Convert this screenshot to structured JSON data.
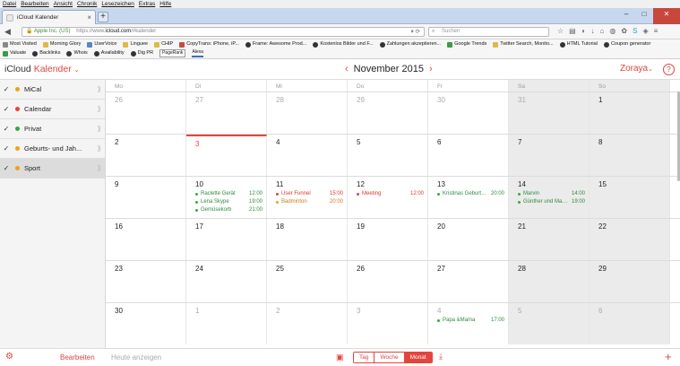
{
  "browser": {
    "menu": [
      "Datei",
      "Bearbeiten",
      "Ansicht",
      "Chronik",
      "Lesezeichen",
      "Extras",
      "Hilfe"
    ],
    "tab_title": "iCloud Kalender",
    "url_identity": "Apple Inc. (US)",
    "url_prefix": "https://www.",
    "url_domain": "icloud.com",
    "url_path": "/#kalender",
    "search_placeholder": "Suchen",
    "bookmarks_row1": [
      "Most Visited",
      "Morning Glory",
      "UserVoice",
      "Linguee",
      "CHIP",
      "CopyTrans: iPhone, iP...",
      "Frame: Awesome Prod...",
      "Kostenlos Bilder und F...",
      "Zahlungen akzeptieren...",
      "Google Trends",
      "Twitter Search, Monito...",
      "HTML Tutorial",
      "Coupon generator"
    ],
    "bookmarks_row2": [
      "Valuate",
      "Backlinks",
      "Whois",
      "Availability",
      "Dig PR",
      "PageRank",
      "Alexa"
    ]
  },
  "app": {
    "brand": "iCloud",
    "module": "Kalender",
    "month": "November",
    "year": "2015",
    "user": "Zoraya",
    "help": "?"
  },
  "sidebar": {
    "calendars": [
      {
        "name": "MiCal",
        "color": "#f0a020"
      },
      {
        "name": "Calendar",
        "color": "#e2453c"
      },
      {
        "name": "Privat",
        "color": "#3aa64a"
      },
      {
        "name": "Geburts- und Jah...",
        "color": "#f0a020"
      },
      {
        "name": "Sport",
        "color": "#f0a020"
      }
    ]
  },
  "bottom": {
    "edit_label": "Bearbeiten",
    "today_label": "Heute anzeigen",
    "views": [
      "Tag",
      "Woche",
      "Monat"
    ],
    "active_view": "Monat"
  },
  "calendar": {
    "weekdays": [
      "Mo",
      "Di",
      "Mi",
      "Do",
      "Fr",
      "Sa",
      "So"
    ],
    "weeks": [
      [
        {
          "d": "26",
          "o": true
        },
        {
          "d": "27",
          "o": true
        },
        {
          "d": "28",
          "o": true
        },
        {
          "d": "29",
          "o": true
        },
        {
          "d": "30",
          "o": true
        },
        {
          "d": "31",
          "o": true
        },
        {
          "d": "1"
        }
      ],
      [
        {
          "d": "2"
        },
        {
          "d": "3",
          "today": true
        },
        {
          "d": "4"
        },
        {
          "d": "5"
        },
        {
          "d": "6"
        },
        {
          "d": "7"
        },
        {
          "d": "8"
        }
      ],
      [
        {
          "d": "9"
        },
        {
          "d": "10",
          "ev": [
            {
              "t": "Raclette Gerät",
              "h": "12:00",
              "c": "green"
            },
            {
              "t": "Lena Skype",
              "h": "19:00",
              "c": "green"
            },
            {
              "t": "Gemüsekorb",
              "h": "21:00",
              "c": "green"
            }
          ]
        },
        {
          "d": "11",
          "ev": [
            {
              "t": "User Funnel",
              "h": "15:00",
              "c": "red"
            },
            {
              "t": "Badminton",
              "h": "20:00",
              "c": "orange"
            }
          ]
        },
        {
          "d": "12",
          "ev": [
            {
              "t": "Meeting",
              "h": "12:00",
              "c": "red"
            }
          ]
        },
        {
          "d": "13",
          "ev": [
            {
              "t": "Kristinas Geburtst...",
              "h": "20:00",
              "c": "green"
            }
          ]
        },
        {
          "d": "14",
          "ev": [
            {
              "t": "Marvin",
              "h": "14:00",
              "c": "green"
            },
            {
              "t": "Günther und Marti...",
              "h": "19:00",
              "c": "green"
            }
          ]
        },
        {
          "d": "15"
        }
      ],
      [
        {
          "d": "16"
        },
        {
          "d": "17"
        },
        {
          "d": "18"
        },
        {
          "d": "19"
        },
        {
          "d": "20"
        },
        {
          "d": "21"
        },
        {
          "d": "22"
        }
      ],
      [
        {
          "d": "23"
        },
        {
          "d": "24"
        },
        {
          "d": "25"
        },
        {
          "d": "26"
        },
        {
          "d": "27"
        },
        {
          "d": "28"
        },
        {
          "d": "29"
        }
      ],
      [
        {
          "d": "30"
        },
        {
          "d": "1",
          "o": true
        },
        {
          "d": "2",
          "o": true
        },
        {
          "d": "3",
          "o": true
        },
        {
          "d": "4",
          "o": true,
          "ev": [
            {
              "t": "Papa &Mama",
              "h": "17:00",
              "c": "green"
            }
          ]
        },
        {
          "d": "5",
          "o": true
        },
        {
          "d": "6",
          "o": true
        }
      ]
    ]
  }
}
